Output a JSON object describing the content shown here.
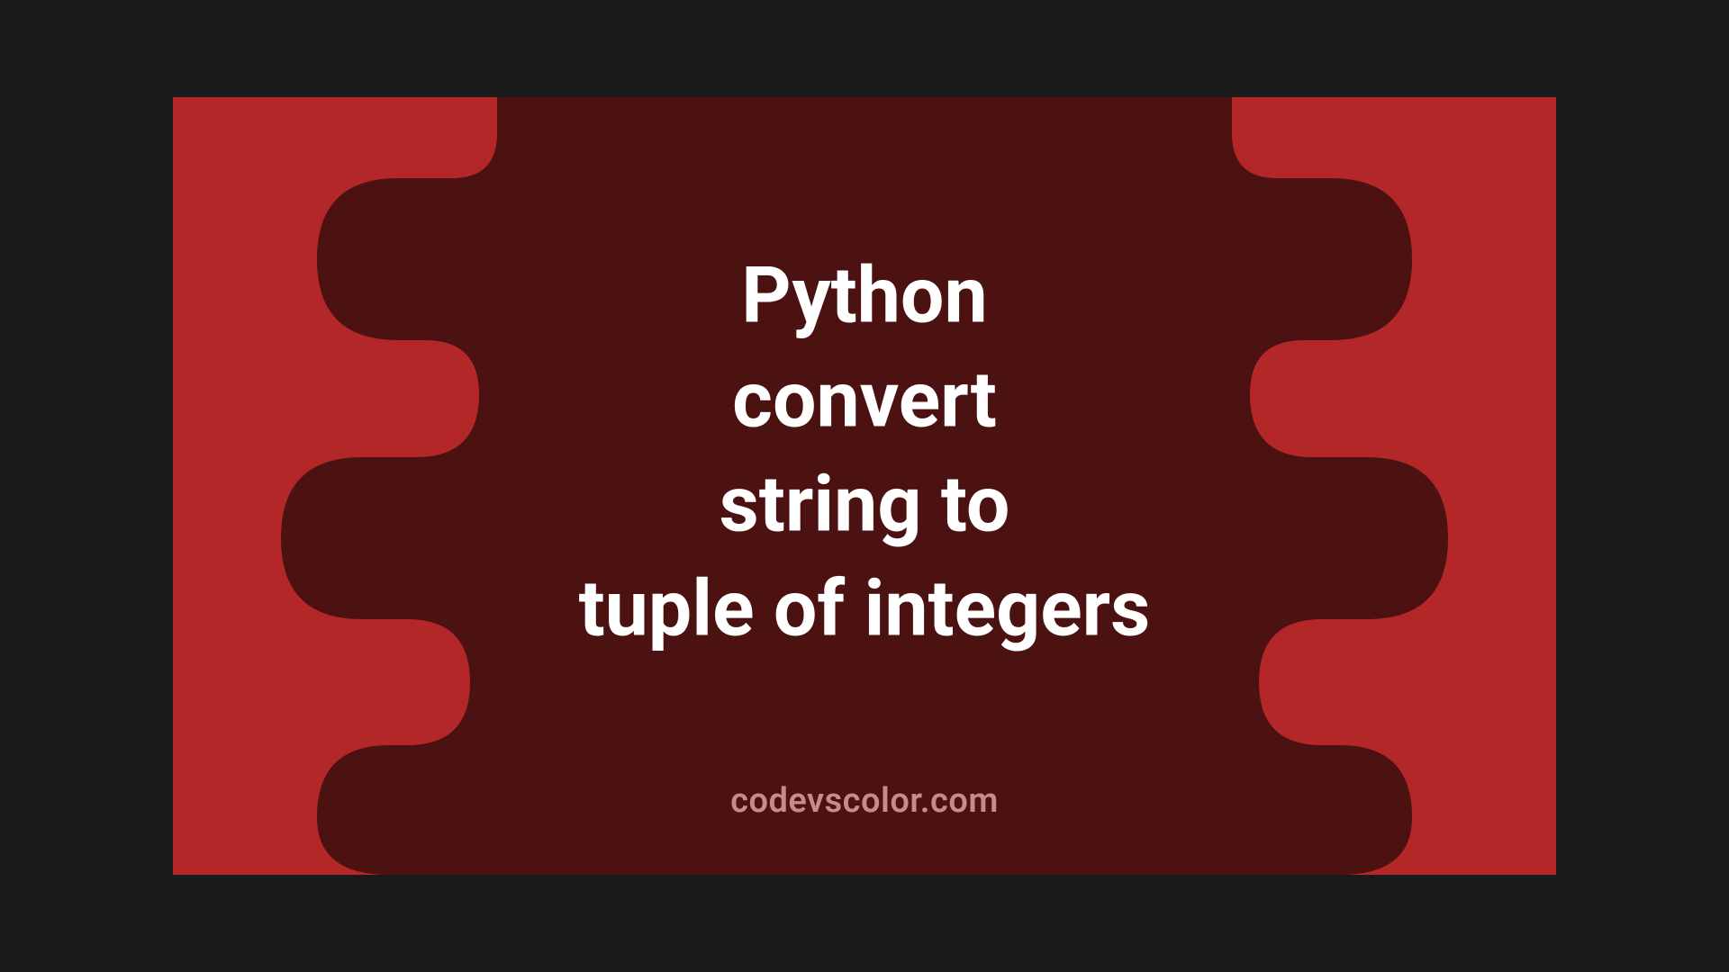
{
  "banner": {
    "title": "Python\nconvert\nstring to\ntuple of integers",
    "watermark": "codevscolor.com",
    "colors": {
      "background": "#b32728",
      "shape": "#4c1111",
      "text": "#ffffff",
      "watermark": "#c98a8a"
    }
  }
}
